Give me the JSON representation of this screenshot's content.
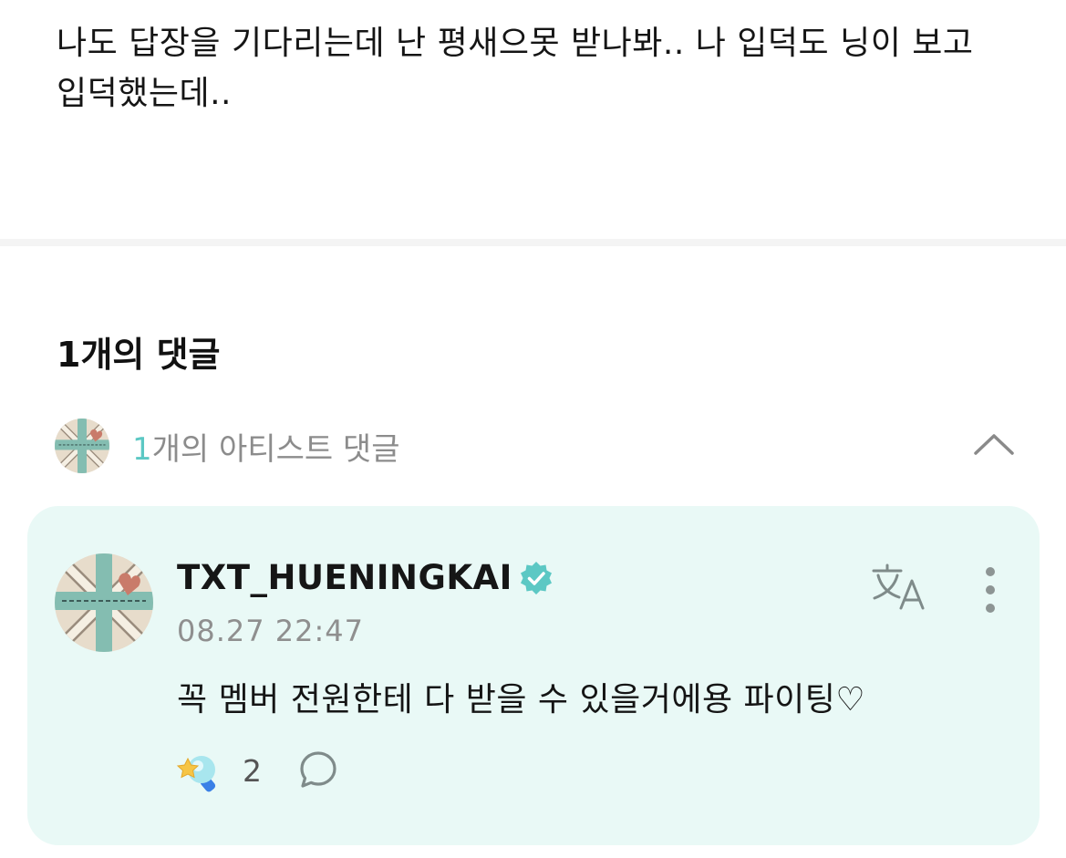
{
  "post": {
    "body": "나도 답장을 기다리는데 난 평새으못 받나봐.. 나 입덕도 닝이 보고 입덕했는데.."
  },
  "comments": {
    "heading": "1개의 댓글",
    "artist_summary": {
      "count": "1",
      "label": "개의 아티스트 댓글"
    },
    "items": [
      {
        "author": "TXT_HUENINGKAI",
        "timestamp": "08.27 22:47",
        "text": "꼭 멤버 전원한테 다 받을 수 있을거에용 파이팅♡",
        "reaction_count": "2",
        "verified": true
      }
    ]
  },
  "icons": {
    "collapse": "chevron-up-icon",
    "verified": "verified-badge-icon",
    "translate": "translate-icon",
    "more": "more-vertical-icon",
    "reaction": "light-stick-reaction-icon",
    "reply": "speech-bubble-icon"
  },
  "colors": {
    "accent": "#5cc8c4",
    "card_background": "#e9f9f6",
    "muted_text": "#8c8c8c"
  }
}
